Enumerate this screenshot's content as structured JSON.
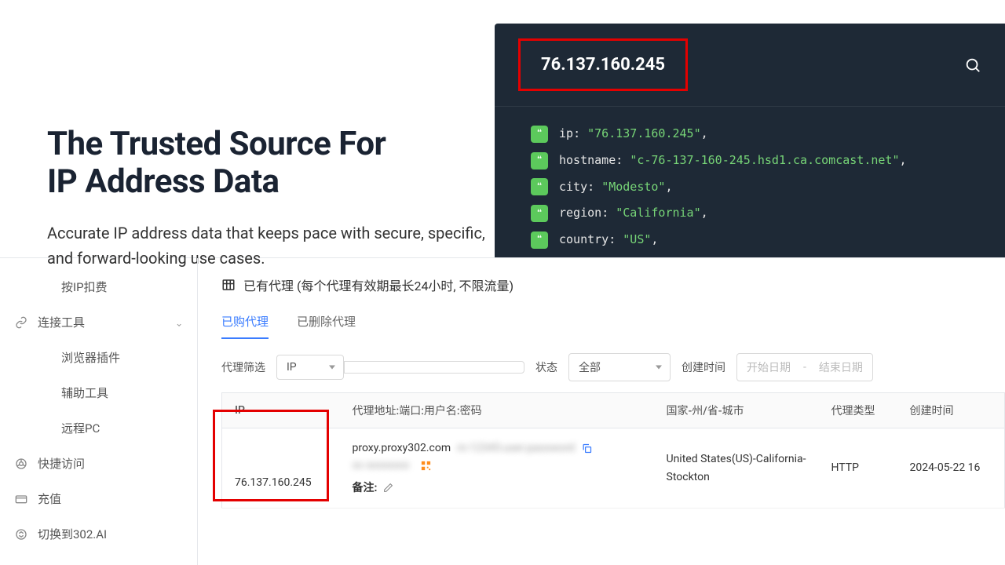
{
  "hero": {
    "title_line1": "The Trusted Source For",
    "title_line2": "IP Address Data",
    "subtitle": "Accurate IP address data that keeps pace with secure, specific, and forward-looking use cases."
  },
  "code_panel": {
    "ip_display": "76.137.160.245",
    "lines": [
      {
        "key": "ip",
        "value": "\"76.137.160.245\""
      },
      {
        "key": "hostname",
        "value": "\"c-76-137-160-245.hsd1.ca.comcast.net\""
      },
      {
        "key": "city",
        "value": "\"Modesto\""
      },
      {
        "key": "region",
        "value": "\"California\""
      },
      {
        "key": "country",
        "value": "\"US\""
      }
    ]
  },
  "sidebar": {
    "items": [
      {
        "label": "按IP扣费",
        "icon": null
      },
      {
        "label": "连接工具",
        "icon": "link",
        "expanded": true
      },
      {
        "label": "浏览器插件",
        "icon": null
      },
      {
        "label": "辅助工具",
        "icon": null
      },
      {
        "label": "远程PC",
        "icon": null
      },
      {
        "label": "快捷访问",
        "icon": "chrome"
      },
      {
        "label": "充值",
        "icon": "card"
      },
      {
        "label": "切换到302.AI",
        "icon": "swap"
      }
    ]
  },
  "main": {
    "header": "已有代理 (每个代理有效期最长24小时, 不限流量)",
    "tabs": {
      "purchased": "已购代理",
      "deleted": "已删除代理"
    },
    "filters": {
      "proxy_filter_label": "代理筛选",
      "proxy_filter_value": "IP",
      "status_label": "状态",
      "status_value": "全部",
      "create_time_label": "创建时间",
      "date_start_placeholder": "开始日期",
      "date_end_placeholder": "结束日期"
    },
    "columns": {
      "ip": "IP",
      "proxy_addr": "代理地址:端口:用户名:密码",
      "country": "国家-州/省-城市",
      "type": "代理类型",
      "created": "创建时间"
    },
    "row": {
      "ip": "76.137.160.245",
      "proxy_addr_visible": "proxy.proxy302.com",
      "proxy_addr_line2_visible": "",
      "remark_label": "备注:",
      "country": "United States(US)-California-Stockton",
      "type": "HTTP",
      "created": "2024-05-22 16"
    }
  }
}
